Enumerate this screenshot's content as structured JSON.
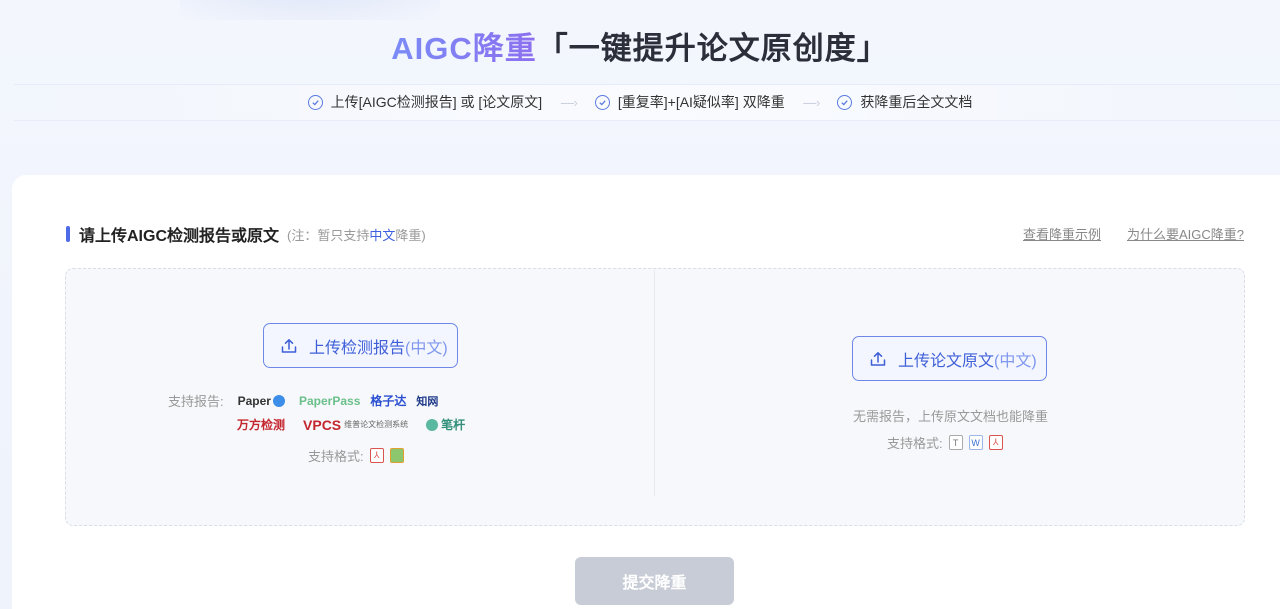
{
  "header": {
    "title_accent": "AIGC降重",
    "title_rest": "「一键提升论文原创度」"
  },
  "steps": [
    {
      "label": "上传[AIGC检测报告] 或 [论文原文]"
    },
    {
      "label": "[重复率]+[AI疑似率] 双降重"
    },
    {
      "label": "获降重后全文文档"
    }
  ],
  "section": {
    "title": "请上传AIGC检测报告或原文",
    "note_prefix": "(注：暂只支持",
    "note_highlight": "中文",
    "note_suffix": "降重)"
  },
  "links": {
    "example": "查看降重示例",
    "why": "为什么要AIGC降重?"
  },
  "left_panel": {
    "button_label": "上传检测报告",
    "button_paren": "(中文)",
    "supports_label": "支持报告:",
    "logos": [
      "Paper",
      "PaperPass",
      "格子达",
      "知网",
      "万方检测",
      "VPCS",
      "维普论文检测系统",
      "笔杆"
    ],
    "formats_label": "支持格式:"
  },
  "right_panel": {
    "button_label": "上传论文原文",
    "button_paren": "(中文)",
    "hint": "无需报告，上传原文文档也能降重",
    "formats_label": "支持格式:"
  },
  "submit": {
    "label": "提交降重"
  },
  "colors": {
    "accent": "#4d6be8",
    "disabled": "#c8ccd6"
  }
}
